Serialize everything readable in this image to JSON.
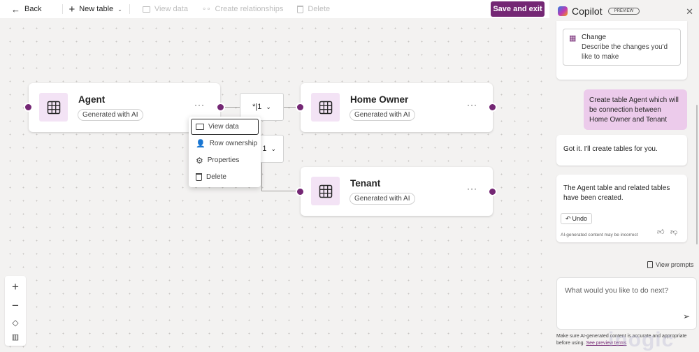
{
  "toolbar": {
    "back": "Back",
    "new_table": "New table",
    "view_data": "View data",
    "create_relationships": "Create relationships",
    "delete": "Delete",
    "save_and_exit": "Save and exit"
  },
  "canvas": {
    "tables": [
      {
        "name": "Agent",
        "badge": "Generated with AI",
        "more": "···"
      },
      {
        "name": "Home Owner",
        "badge": "Generated with AI",
        "more": "···"
      },
      {
        "name": "Tenant",
        "badge": "Generated with AI",
        "more": "···"
      }
    ],
    "relationships": [
      {
        "label": "*|1"
      },
      {
        "label": "1"
      }
    ],
    "context_menu": [
      {
        "label": "View data",
        "icon": "view-data-icon",
        "focused": true
      },
      {
        "label": "Row ownership",
        "icon": "row-ownership-icon"
      },
      {
        "label": "Properties",
        "icon": "gear-icon"
      },
      {
        "label": "Delete",
        "icon": "trash-icon"
      }
    ],
    "zoom_controls": [
      "zoom-in",
      "zoom-out",
      "fit-view",
      "minimap"
    ]
  },
  "copilot": {
    "title": "Copilot",
    "badge": "PREVIEW",
    "suggestion": {
      "title": "Change",
      "description": "Describe the changes you'd like to make"
    },
    "user_message": "Create table Agent which will be connection between Home Owner and Tenant",
    "bot_messages": [
      "Got it. I'll create tables for you.",
      "The Agent table and related tables have been created."
    ],
    "undo": "Undo",
    "ai_note": "AI-generated content may be incorrect",
    "view_prompts": "View prompts",
    "input_placeholder": "What would you like to do next?",
    "disclaimer": "Make sure AI-generated content is accurate and appropriate before using.",
    "preview_terms": "See preview terms",
    "watermark": "inogic"
  },
  "colors": {
    "accent": "#742774",
    "icon_bg": "#f3e3f5",
    "user_bubble": "#eccbeb"
  }
}
